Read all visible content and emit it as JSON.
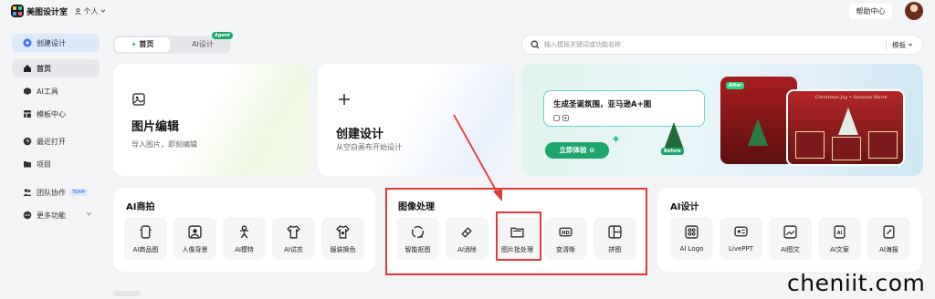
{
  "header": {
    "brand": "美图设计室",
    "persona": "个人",
    "help": "帮助中心"
  },
  "sidebar": {
    "items": [
      {
        "label": "创建设计",
        "icon": "plus-circle-icon"
      },
      {
        "label": "首页",
        "icon": "home-icon"
      },
      {
        "label": "AI工具",
        "icon": "cube-icon"
      },
      {
        "label": "模板中心",
        "icon": "grid-icon"
      },
      {
        "label": "最近打开",
        "icon": "clock-icon"
      },
      {
        "label": "项目",
        "icon": "folder-icon"
      },
      {
        "label": "团队协作",
        "icon": "team-icon",
        "badge": "TEAM"
      },
      {
        "label": "更多功能",
        "icon": "more-icon"
      }
    ]
  },
  "tabs": {
    "home": "首页",
    "ai": "AI设计",
    "agent_badge": "Agent"
  },
  "search": {
    "placeholder": "输入模板关键词或功能名称",
    "scope": "模板"
  },
  "cards": {
    "edit": {
      "title": "图片编辑",
      "subtitle": "导入图片，即刻编辑"
    },
    "create": {
      "title": "创建设计",
      "subtitle": "从空白画布开始设计"
    }
  },
  "banner": {
    "prompt": "生成圣诞氛围，亚马逊A+图",
    "cta": "立即体验",
    "poster_text": "Christmas Joy • Seasons Warm",
    "tag_after": "After",
    "tag_before": "Before"
  },
  "sections": {
    "commerce": {
      "title": "AI商拍",
      "tools": [
        "AI商品图",
        "人像背景",
        "AI模特",
        "AI试衣",
        "服装换色"
      ]
    },
    "image": {
      "title": "图像处理",
      "tools": [
        "智能抠图",
        "AI消除",
        "图片批处理",
        "变清晰",
        "拼图"
      ]
    },
    "design": {
      "title": "AI设计",
      "tools": [
        "AI Logo",
        "LivePPT",
        "AI图文",
        "AI文案",
        "AI海报"
      ]
    }
  },
  "watermark": "cheniit.com",
  "colors": {
    "accent_green": "#1fa56e",
    "highlight_red": "#e03a3a",
    "nav_active": "#dde8fb"
  }
}
